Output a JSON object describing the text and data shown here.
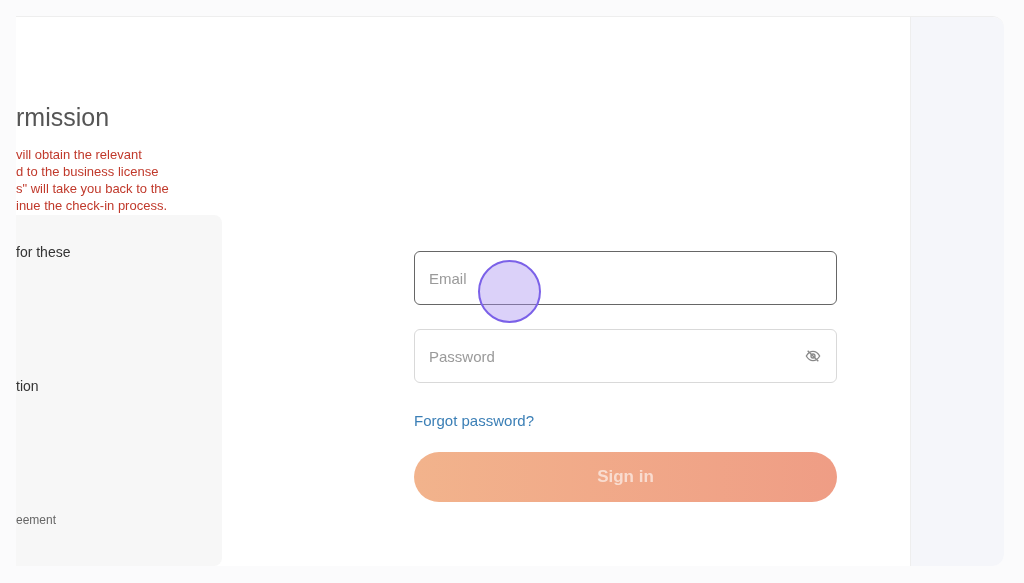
{
  "left_panel": {
    "heading": "rmission",
    "notice_lines": [
      "vill obtain the relevant",
      "d to the business license",
      "s\" will take you back to the",
      "inue the check-in process."
    ],
    "card_texts": [
      {
        "kind": "item",
        "text": "for these"
      },
      {
        "kind": "item",
        "text": "tion"
      },
      {
        "kind": "note",
        "text": "eement"
      }
    ]
  },
  "login_form": {
    "fields": [
      {
        "kind": "email",
        "placeholder": "Email",
        "focused": true
      },
      {
        "kind": "password",
        "placeholder": "Password",
        "focused": false
      }
    ],
    "forgot_link": "Forgot password?",
    "submit": {
      "label": "Sign in",
      "disabled": true
    }
  }
}
